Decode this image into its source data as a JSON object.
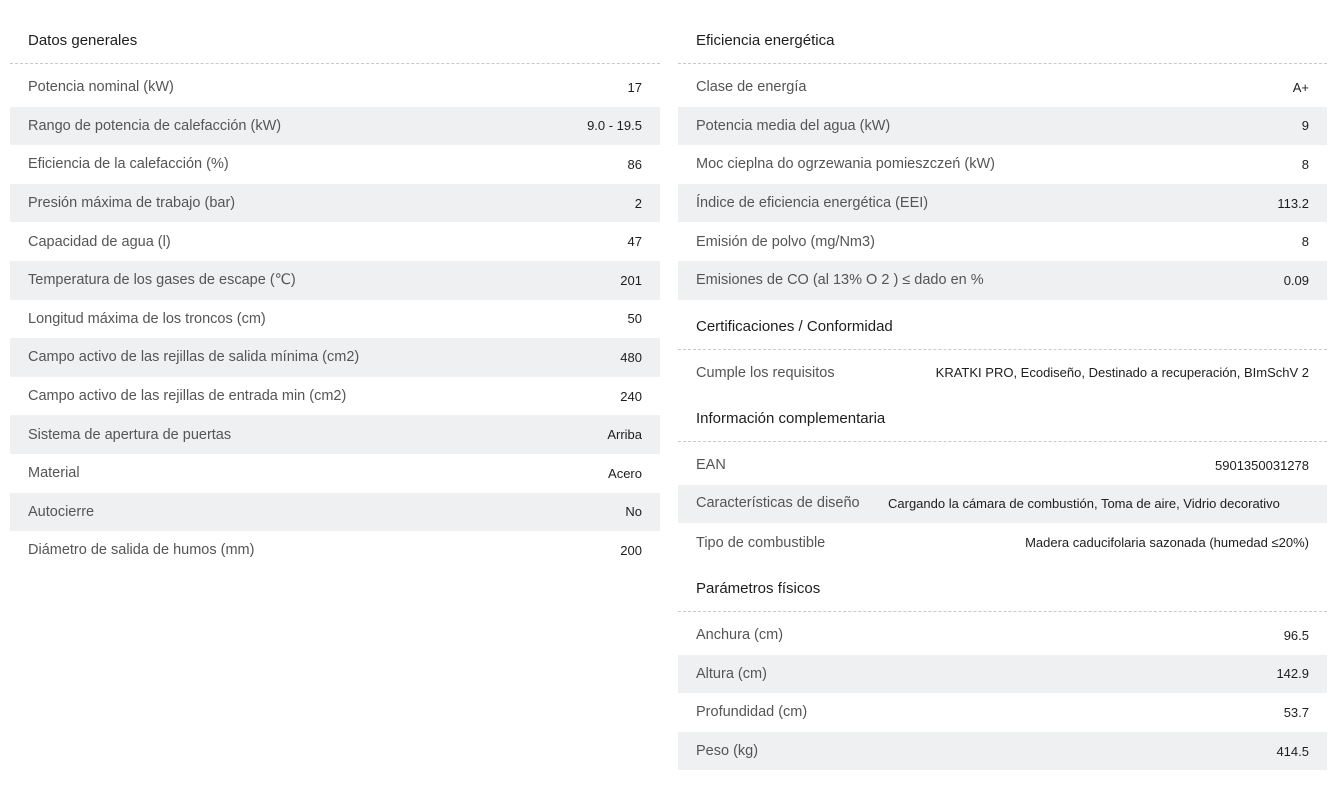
{
  "general": {
    "title": "Datos generales",
    "rows": [
      {
        "label": "Potencia nominal (kW)",
        "value": "17"
      },
      {
        "label": "Rango de potencia de calefacción (kW)",
        "value": "9.0 - 19.5"
      },
      {
        "label": "Eficiencia de la calefacción (%)",
        "value": "86"
      },
      {
        "label": "Presión máxima de trabajo (bar)",
        "value": "2"
      },
      {
        "label": "Capacidad de agua (l)",
        "value": "47"
      },
      {
        "label": "Temperatura de los gases de escape (℃)",
        "value": "201"
      },
      {
        "label": "Longitud máxima de los troncos (cm)",
        "value": "50"
      },
      {
        "label": "Campo activo de las rejillas de salida mínima (cm2)",
        "value": "480"
      },
      {
        "label": "Campo activo de las rejillas de entrada min (cm2)",
        "value": "240"
      },
      {
        "label": "Sistema de apertura de puertas",
        "value": "Arriba"
      },
      {
        "label": "Material",
        "value": "Acero"
      },
      {
        "label": "Autocierre",
        "value": "No"
      },
      {
        "label": "Diámetro de salida de humos (mm)",
        "value": "200"
      }
    ]
  },
  "energy": {
    "title": "Eficiencia energética",
    "rows": [
      {
        "label": "Clase de energía",
        "value": "A+"
      },
      {
        "label": "Potencia media del agua (kW)",
        "value": "9"
      },
      {
        "label": "Moc cieplna do ogrzewania pomieszczeń (kW)",
        "value": "8"
      },
      {
        "label": "Índice de eficiencia energética (EEI)",
        "value": "113.2"
      },
      {
        "label": "Emisión de polvo (mg/Nm3)",
        "value": "8"
      },
      {
        "label": "Emisiones de CO (al 13% O 2 ) ≤ dado en %",
        "value": "0.09"
      }
    ]
  },
  "certs": {
    "title": "Certificaciones / Conformidad",
    "rows": [
      {
        "label": "Cumple los requisitos",
        "value": "KRATKI PRO, Ecodiseño, Destinado a recuperación, BImSchV 2"
      }
    ]
  },
  "extra": {
    "title": "Información complementaria",
    "rows": [
      {
        "label": "EAN",
        "value": "5901350031278"
      },
      {
        "label": "Características de diseño",
        "value": "Cargando la cámara de combustión, Toma de aire, Vidrio decorativo"
      },
      {
        "label": "Tipo de combustible",
        "value": "Madera caducifolaria sazonada (humedad ≤20%)"
      }
    ]
  },
  "physical": {
    "title": "Parámetros físicos",
    "rows": [
      {
        "label": "Anchura (cm)",
        "value": "96.5"
      },
      {
        "label": "Altura (cm)",
        "value": "142.9"
      },
      {
        "label": "Profundidad (cm)",
        "value": "53.7"
      },
      {
        "label": "Peso (kg)",
        "value": "414.5"
      }
    ]
  }
}
